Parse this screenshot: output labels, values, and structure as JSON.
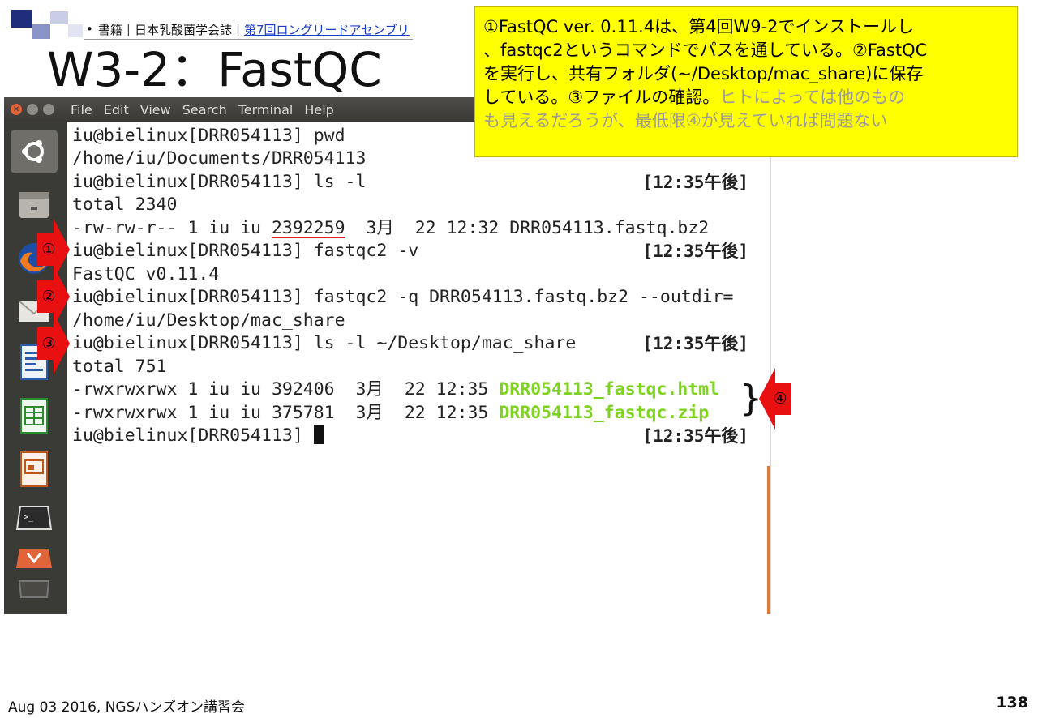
{
  "header": {
    "citation": {
      "bullet": "•",
      "part1": "書籍",
      "part2": "日本乳酸菌学会誌",
      "link": "第7回ロングリードアセンブリ"
    },
    "title": "W3-2：FastQC"
  },
  "callout": {
    "line1": "①FastQC ver. 0.11.4は、第4回W9-2でインストールし",
    "line2": "、fastqc2というコマンドでパスを通している。②FastQC",
    "line3": "を実行し、共有フォルダ(~/Desktop/mac_share)に保存",
    "line4_black": "している。③ファイルの確認。",
    "line4_gray": "ヒトによっては他のもの",
    "line5_gray": "も見えるだろうが、最低限④が見えていれば問題ない"
  },
  "window": {
    "menu": [
      "File",
      "Edit",
      "View",
      "Search",
      "Terminal",
      "Help"
    ]
  },
  "terminal": {
    "lines": {
      "l0": "iu@bielinux[DRR054113] pwd",
      "l1": "/home/iu/Documents/DRR054113",
      "l2": "iu@bielinux[DRR054113] ls -l",
      "l3": "total 2340",
      "l4_pre": "-rw-rw-r-- 1 iu iu ",
      "l4_size": "2392259",
      "l4_post": "  3月  22 12:32 DRR054113.fastq.bz2",
      "l5": "iu@bielinux[DRR054113] fastqc2 -v",
      "l6": "FastQC v0.11.4",
      "l7": "iu@bielinux[DRR054113] fastqc2 -q DRR054113.fastq.bz2 --outdir=",
      "l8": "/home/iu/Desktop/mac_share",
      "l9": "iu@bielinux[DRR054113] ls -l ~/Desktop/mac_share",
      "l10": "total 751",
      "l11_pre": "-rwxrwxrwx 1 iu iu 392406  3月  22 12:35 ",
      "l11_file": "DRR054113_fastqc.html",
      "l12_pre": "-rwxrwxrwx 1 iu iu 375781  3月  22 12:35 ",
      "l12_file": "DRR054113_fastqc.zip",
      "l13": "iu@bielinux[DRR054113] "
    },
    "timestamp": "[12:35午後]"
  },
  "annotations": {
    "n1": "①",
    "n2": "②",
    "n3": "③",
    "n4": "④"
  },
  "footer": {
    "left": "Aug 03 2016, NGSハンズオン講習会",
    "page": "138"
  },
  "colors": {
    "callout_bg": "#ffff00",
    "arrow": "#e81010",
    "green_file": "#7ed321"
  },
  "icons": [
    "ubuntu-logo-icon",
    "files-icon",
    "firefox-icon",
    "mail-icon",
    "writer-icon",
    "calc-icon",
    "impress-icon",
    "terminal-app-icon",
    "software-center-icon",
    "trash-icon"
  ]
}
